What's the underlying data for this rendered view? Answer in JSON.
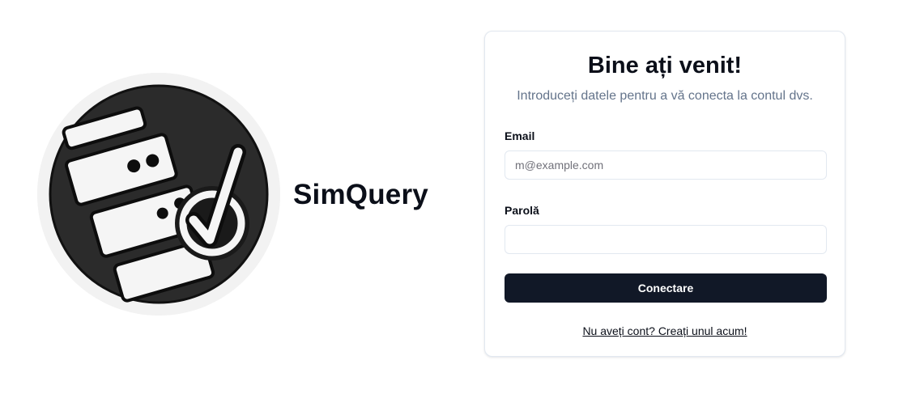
{
  "brand": {
    "name": "SimQuery",
    "logo_icon": "database-check-icon"
  },
  "login": {
    "title": "Bine ați venit!",
    "subtitle": "Introduceți datele pentru a vă conecta la contul dvs.",
    "email_label": "Email",
    "email_placeholder": "m@example.com",
    "email_value": "",
    "password_label": "Parolă",
    "password_value": "",
    "submit_label": "Conectare",
    "signup_link": "Nu aveți cont? Creați unul acum!"
  },
  "colors": {
    "button_bg": "#111827",
    "muted_text": "#64748b",
    "border": "#e2e8f0"
  }
}
